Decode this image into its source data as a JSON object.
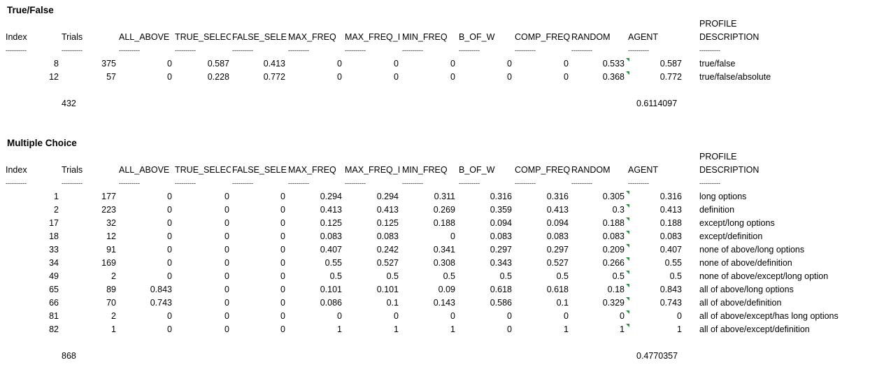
{
  "sections": [
    {
      "title": "True/False",
      "header_profile_top": "PROFILE",
      "headers": [
        "Index",
        "Trials",
        "ALL_ABOVE",
        "TRUE_SELECT",
        "FALSE_SELEC",
        "MAX_FREQ",
        "MAX_FREQ_I",
        "MIN_FREQ",
        "B_OF_W",
        "COMP_FREQ",
        "RANDOM",
        "AGENT",
        "DESCRIPTION"
      ],
      "dash": "----------",
      "rows": [
        {
          "index": "8",
          "trials": "375",
          "all_above": "0",
          "true_select": "0.587",
          "false_select": "0.413",
          "max_freq": "0",
          "max_freq_i": "0",
          "min_freq": "0",
          "b_of_w": "0",
          "comp_freq": "0",
          "random": "0.533",
          "agent": "0.587",
          "description": "true/false"
        },
        {
          "index": "12",
          "trials": "57",
          "all_above": "0",
          "true_select": "0.228",
          "false_select": "0.772",
          "max_freq": "0",
          "max_freq_i": "0",
          "min_freq": "0",
          "b_of_w": "0",
          "comp_freq": "0",
          "random": "0.368",
          "agent": "0.772",
          "description": "true/false/absolute"
        }
      ],
      "total_trials": "432",
      "total_agent": "0.6114097"
    },
    {
      "title": "Multiple Choice",
      "header_profile_top": "PROFILE",
      "headers": [
        "Index",
        "Trials",
        "ALL_ABOVE",
        "TRUE_SELECT",
        "FALSE_SELEC",
        "MAX_FREQ",
        "MAX_FREQ_I",
        "MIN_FREQ",
        "B_OF_W",
        "COMP_FREQ",
        "RANDOM",
        "AGENT",
        "DESCRIPTION"
      ],
      "dash": "----------",
      "rows": [
        {
          "index": "1",
          "trials": "177",
          "all_above": "0",
          "true_select": "0",
          "false_select": "0",
          "max_freq": "0.294",
          "max_freq_i": "0.294",
          "min_freq": "0.311",
          "b_of_w": "0.316",
          "comp_freq": "0.316",
          "random": "0.305",
          "agent": "0.316",
          "description": "long options"
        },
        {
          "index": "2",
          "trials": "223",
          "all_above": "0",
          "true_select": "0",
          "false_select": "0",
          "max_freq": "0.413",
          "max_freq_i": "0.413",
          "min_freq": "0.269",
          "b_of_w": "0.359",
          "comp_freq": "0.413",
          "random": "0.3",
          "agent": "0.413",
          "description": "definition"
        },
        {
          "index": "17",
          "trials": "32",
          "all_above": "0",
          "true_select": "0",
          "false_select": "0",
          "max_freq": "0.125",
          "max_freq_i": "0.125",
          "min_freq": "0.188",
          "b_of_w": "0.094",
          "comp_freq": "0.094",
          "random": "0.188",
          "agent": "0.188",
          "description": "except/long options"
        },
        {
          "index": "18",
          "trials": "12",
          "all_above": "0",
          "true_select": "0",
          "false_select": "0",
          "max_freq": "0.083",
          "max_freq_i": "0.083",
          "min_freq": "0",
          "b_of_w": "0.083",
          "comp_freq": "0.083",
          "random": "0.083",
          "agent": "0.083",
          "description": "except/definition"
        },
        {
          "index": "33",
          "trials": "91",
          "all_above": "0",
          "true_select": "0",
          "false_select": "0",
          "max_freq": "0.407",
          "max_freq_i": "0.242",
          "min_freq": "0.341",
          "b_of_w": "0.297",
          "comp_freq": "0.297",
          "random": "0.209",
          "agent": "0.407",
          "description": "none of above/long options"
        },
        {
          "index": "34",
          "trials": "169",
          "all_above": "0",
          "true_select": "0",
          "false_select": "0",
          "max_freq": "0.55",
          "max_freq_i": "0.527",
          "min_freq": "0.308",
          "b_of_w": "0.343",
          "comp_freq": "0.527",
          "random": "0.266",
          "agent": "0.55",
          "description": "none of above/definition"
        },
        {
          "index": "49",
          "trials": "2",
          "all_above": "0",
          "true_select": "0",
          "false_select": "0",
          "max_freq": "0.5",
          "max_freq_i": "0.5",
          "min_freq": "0.5",
          "b_of_w": "0.5",
          "comp_freq": "0.5",
          "random": "0.5",
          "agent": "0.5",
          "description": "none of above/except/long option"
        },
        {
          "index": "65",
          "trials": "89",
          "all_above": "0.843",
          "true_select": "0",
          "false_select": "0",
          "max_freq": "0.101",
          "max_freq_i": "0.101",
          "min_freq": "0.09",
          "b_of_w": "0.618",
          "comp_freq": "0.618",
          "random": "0.18",
          "agent": "0.843",
          "description": "all of above/long options"
        },
        {
          "index": "66",
          "trials": "70",
          "all_above": "0.743",
          "true_select": "0",
          "false_select": "0",
          "max_freq": "0.086",
          "max_freq_i": "0.1",
          "min_freq": "0.143",
          "b_of_w": "0.586",
          "comp_freq": "0.1",
          "random": "0.329",
          "agent": "0.743",
          "description": "all of above/definition"
        },
        {
          "index": "81",
          "trials": "2",
          "all_above": "0",
          "true_select": "0",
          "false_select": "0",
          "max_freq": "0",
          "max_freq_i": "0",
          "min_freq": "0",
          "b_of_w": "0",
          "comp_freq": "0",
          "random": "0",
          "agent": "0",
          "description": "all of above/except/has long options"
        },
        {
          "index": "82",
          "trials": "1",
          "all_above": "0",
          "true_select": "0",
          "false_select": "0",
          "max_freq": "1",
          "max_freq_i": "1",
          "min_freq": "1",
          "b_of_w": "0",
          "comp_freq": "1",
          "random": "1",
          "agent": "1",
          "description": "all of above/except/definition"
        }
      ],
      "total_trials": "868",
      "total_agent": "0.4770357"
    }
  ],
  "colors": {
    "comment_marker": "#1f9a3a",
    "text": "#000000",
    "background": "#ffffff"
  }
}
